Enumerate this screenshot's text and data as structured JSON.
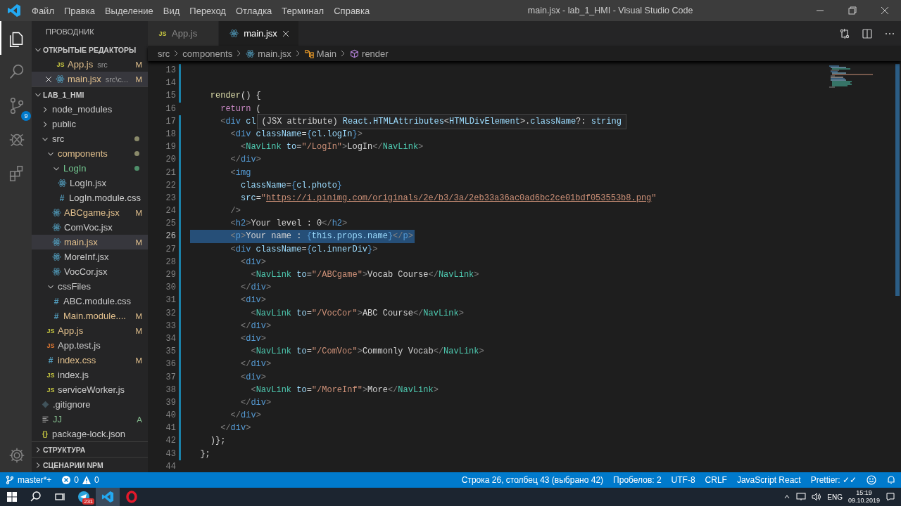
{
  "window": {
    "title": "main.jsx - lab_1_HMI - Visual Studio Code"
  },
  "menu": [
    "Файл",
    "Правка",
    "Выделение",
    "Вид",
    "Переход",
    "Отладка",
    "Терминал",
    "Справка"
  ],
  "activity_bar": [
    {
      "kind": "explorer",
      "selected": true
    },
    {
      "kind": "search",
      "selected": false
    },
    {
      "kind": "scm",
      "selected": false,
      "badge": "9"
    },
    {
      "kind": "debug",
      "selected": false
    },
    {
      "kind": "extensions",
      "selected": false
    }
  ],
  "sidebar": {
    "title": "ПРОВОДНИК",
    "open_editors": {
      "title": "ОТКРЫТЫЕ РЕДАКТОРЫ",
      "expanded": true,
      "items": [
        {
          "name": "App.js",
          "kind": "js",
          "icon": "JS",
          "description": "src",
          "status": "M",
          "color": "#e2c08d",
          "selected": false
        },
        {
          "name": "main.jsx",
          "kind": "react",
          "description": "src\\c...",
          "status": "M",
          "color": "#e2c08d",
          "selected": true
        }
      ]
    },
    "project": {
      "title": "LAB_1_HMI",
      "expanded": true,
      "tree": [
        {
          "name": "node_modules",
          "kind": "folder",
          "expanded": false,
          "color": "#cccccc",
          "selected": false
        },
        {
          "name": "public",
          "kind": "folder",
          "expanded": false,
          "color": "#cccccc",
          "selected": false
        },
        {
          "name": "src",
          "kind": "folder",
          "expanded": true,
          "color": "#cccccc",
          "dot": {
            "color": "#8a8a6a"
          },
          "selected": false,
          "children": [
            {
              "name": "components",
              "kind": "folder",
              "expanded": true,
              "color": "#e2c08d",
              "dot": {
                "color": "#8a8a6a"
              },
              "selected": false,
              "children": [
                {
                  "name": "LogIn",
                  "kind": "folder",
                  "expanded": true,
                  "color": "#73c991",
                  "dot": {
                    "color": "#4f8f6a"
                  },
                  "selected": false,
                  "children": [
                    {
                      "name": "LogIn.jsx",
                      "kind": "react",
                      "color": "#cccccc",
                      "selected": false
                    },
                    {
                      "name": "LogIn.module.css",
                      "kind": "css",
                      "icon": "#",
                      "color": "#cccccc",
                      "selected": false
                    }
                  ]
                },
                {
                  "name": "ABCgame.jsx",
                  "kind": "react",
                  "color": "#e2c08d",
                  "status": "M",
                  "selected": false
                },
                {
                  "name": "ComVoc.jsx",
                  "kind": "react",
                  "color": "#cccccc",
                  "selected": false
                },
                {
                  "name": "main.jsx",
                  "kind": "react",
                  "color": "#e2c08d",
                  "status": "M",
                  "selected": true
                },
                {
                  "name": "MoreInf.jsx",
                  "kind": "react",
                  "color": "#cccccc",
                  "selected": false
                },
                {
                  "name": "VocCor.jsx",
                  "kind": "react",
                  "color": "#cccccc",
                  "selected": false
                }
              ]
            },
            {
              "name": "cssFiles",
              "kind": "folder",
              "expanded": true,
              "color": "#cccccc",
              "selected": false,
              "children": [
                {
                  "name": "ABC.module.css",
                  "kind": "css",
                  "icon": "#",
                  "color": "#cccccc",
                  "selected": false
                },
                {
                  "name": "Main.module....",
                  "kind": "css",
                  "icon": "#",
                  "color": "#e2c08d",
                  "status": "M",
                  "selected": false
                }
              ]
            },
            {
              "name": "App.js",
              "kind": "js",
              "icon": "JS",
              "color": "#e2c08d",
              "status": "M",
              "selected": false
            },
            {
              "name": "App.test.js",
              "kind": "js-test",
              "icon": "JS",
              "color": "#cccccc",
              "selected": false
            },
            {
              "name": "index.css",
              "kind": "css",
              "icon": "#",
              "color": "#e2c08d",
              "status": "M",
              "selected": false
            },
            {
              "name": "index.js",
              "kind": "js",
              "icon": "JS",
              "color": "#cccccc",
              "selected": false
            },
            {
              "name": "serviceWorker.js",
              "kind": "js",
              "icon": "JS",
              "color": "#cccccc",
              "selected": false
            }
          ]
        },
        {
          "name": ".gitignore",
          "kind": "git",
          "color": "#cccccc",
          "selected": false
        },
        {
          "name": "JJ",
          "kind": "text",
          "color": "#81b88b",
          "status": "A",
          "selected": false
        },
        {
          "name": "package-lock.json",
          "kind": "json",
          "icon": "{}",
          "color": "#cccccc",
          "selected": false
        }
      ]
    },
    "bottom_sections": [
      {
        "title": "СТРУКТУРА",
        "expanded": false
      },
      {
        "title": "СЦЕНАРИИ NPM",
        "expanded": false
      }
    ]
  },
  "tabs": [
    {
      "label": "App.js",
      "kind": "js",
      "icon": "JS",
      "selected": false
    },
    {
      "label": "main.jsx",
      "kind": "react",
      "selected": true
    }
  ],
  "breadcrumbs": [
    {
      "label": "src",
      "kind": "plain"
    },
    {
      "label": "components",
      "kind": "plain"
    },
    {
      "label": "main.jsx",
      "kind": "react"
    },
    {
      "label": "Main",
      "kind": "class"
    },
    {
      "label": "render",
      "kind": "method"
    }
  ],
  "editor": {
    "lines": [
      {
        "n": "13",
        "modified": true,
        "selected": false
      },
      {
        "n": "14",
        "modified": true,
        "selected": false
      },
      {
        "n": "15",
        "modified": true,
        "selected": false,
        "tokens": [
          {
            "kind": "func",
            "text": "    render"
          },
          {
            "kind": "punct",
            "text": "() {"
          }
        ]
      },
      {
        "n": "16",
        "modified": false,
        "selected": false,
        "tokens": [
          {
            "kind": "keyword",
            "text": "      return"
          },
          {
            "kind": "punct",
            "text": " ("
          }
        ]
      },
      {
        "n": "17",
        "modified": true,
        "selected": false,
        "tokens": [
          {
            "kind": "bracket",
            "text": "      <"
          },
          {
            "kind": "tag",
            "text": "div"
          },
          {
            "kind": "attr",
            "text": " cl"
          }
        ]
      },
      {
        "n": "18",
        "modified": true,
        "selected": false,
        "tokens": [
          {
            "kind": "bracket",
            "text": "        <"
          },
          {
            "kind": "tag",
            "text": "div"
          },
          {
            "kind": "attr",
            "text": " className"
          },
          {
            "kind": "punct",
            "text": "="
          },
          {
            "kind": "tag",
            "text": "{"
          },
          {
            "kind": "attr",
            "text": "cl.logIn"
          },
          {
            "kind": "tag",
            "text": "}"
          },
          {
            "kind": "bracket",
            "text": ">"
          }
        ]
      },
      {
        "n": "19",
        "modified": true,
        "selected": false,
        "tokens": [
          {
            "kind": "bracket",
            "text": "          <"
          },
          {
            "kind": "comp",
            "text": "NavLink"
          },
          {
            "kind": "attr",
            "text": " to"
          },
          {
            "kind": "punct",
            "text": "="
          },
          {
            "kind": "string",
            "text": "\"/LogIn\""
          },
          {
            "kind": "bracket",
            "text": ">"
          },
          {
            "kind": "text",
            "text": "LogIn"
          },
          {
            "kind": "bracket",
            "text": "</"
          },
          {
            "kind": "comp",
            "text": "NavLink"
          },
          {
            "kind": "bracket",
            "text": ">"
          }
        ]
      },
      {
        "n": "20",
        "modified": true,
        "selected": false,
        "tokens": [
          {
            "kind": "bracket",
            "text": "        </"
          },
          {
            "kind": "tag",
            "text": "div"
          },
          {
            "kind": "bracket",
            "text": ">"
          }
        ]
      },
      {
        "n": "21",
        "modified": true,
        "selected": false,
        "tokens": [
          {
            "kind": "bracket",
            "text": "        <"
          },
          {
            "kind": "tag",
            "text": "img"
          }
        ]
      },
      {
        "n": "22",
        "modified": true,
        "selected": false,
        "tokens": [
          {
            "kind": "attr",
            "text": "          className"
          },
          {
            "kind": "punct",
            "text": "="
          },
          {
            "kind": "tag",
            "text": "{"
          },
          {
            "kind": "attr",
            "text": "cl.photo"
          },
          {
            "kind": "tag",
            "text": "}"
          }
        ]
      },
      {
        "n": "23",
        "modified": true,
        "selected": false,
        "tokens": [
          {
            "kind": "attr",
            "text": "          src"
          },
          {
            "kind": "punct",
            "text": "="
          },
          {
            "kind": "string",
            "text": "\""
          },
          {
            "kind": "link",
            "text": "https://i.pinimg.com/originals/2e/b3/3a/2eb33a36ac0ad6bc2ce01bdf053553b8.png"
          },
          {
            "kind": "string",
            "text": "\""
          }
        ]
      },
      {
        "n": "24",
        "modified": true,
        "selected": false,
        "tokens": [
          {
            "kind": "bracket",
            "text": "        />"
          }
        ]
      },
      {
        "n": "25",
        "modified": true,
        "selected": false,
        "tokens": [
          {
            "kind": "bracket",
            "text": "        <"
          },
          {
            "kind": "tag",
            "text": "h2"
          },
          {
            "kind": "bracket",
            "text": ">"
          },
          {
            "kind": "text",
            "text": "Your level : 0"
          },
          {
            "kind": "bracket",
            "text": "</"
          },
          {
            "kind": "tag",
            "text": "h2"
          },
          {
            "kind": "bracket",
            "text": ">"
          }
        ]
      },
      {
        "n": "26",
        "modified": true,
        "selected": true,
        "tokens": [
          {
            "kind": "bracket",
            "text": "        <"
          },
          {
            "kind": "tag",
            "text": "p"
          },
          {
            "kind": "bracket",
            "text": ">"
          },
          {
            "kind": "text",
            "text": "Your name : "
          },
          {
            "kind": "tag",
            "text": "{"
          },
          {
            "kind": "attr",
            "text": "this.props.name"
          },
          {
            "kind": "tag",
            "text": "}"
          },
          {
            "kind": "bracket",
            "text": "</"
          },
          {
            "kind": "tag",
            "text": "p"
          },
          {
            "kind": "bracket",
            "text": ">"
          }
        ]
      },
      {
        "n": "27",
        "modified": true,
        "selected": false,
        "tokens": [
          {
            "kind": "bracket",
            "text": "        <"
          },
          {
            "kind": "tag",
            "text": "div"
          },
          {
            "kind": "attr",
            "text": " className"
          },
          {
            "kind": "punct",
            "text": "="
          },
          {
            "kind": "tag",
            "text": "{"
          },
          {
            "kind": "attr",
            "text": "cl.innerDiv"
          },
          {
            "kind": "tag",
            "text": "}"
          },
          {
            "kind": "bracket",
            "text": ">"
          }
        ]
      },
      {
        "n": "28",
        "modified": true,
        "selected": false,
        "tokens": [
          {
            "kind": "bracket",
            "text": "          <"
          },
          {
            "kind": "tag",
            "text": "div"
          },
          {
            "kind": "bracket",
            "text": ">"
          }
        ]
      },
      {
        "n": "29",
        "modified": true,
        "selected": false,
        "tokens": [
          {
            "kind": "bracket",
            "text": "            <"
          },
          {
            "kind": "comp",
            "text": "NavLink"
          },
          {
            "kind": "attr",
            "text": " to"
          },
          {
            "kind": "punct",
            "text": "="
          },
          {
            "kind": "string",
            "text": "\"/ABCgame\""
          },
          {
            "kind": "bracket",
            "text": ">"
          },
          {
            "kind": "text",
            "text": "Vocab Course"
          },
          {
            "kind": "bracket",
            "text": "</"
          },
          {
            "kind": "comp",
            "text": "NavLink"
          },
          {
            "kind": "bracket",
            "text": ">"
          }
        ]
      },
      {
        "n": "30",
        "modified": true,
        "selected": false,
        "tokens": [
          {
            "kind": "bracket",
            "text": "          </"
          },
          {
            "kind": "tag",
            "text": "div"
          },
          {
            "kind": "bracket",
            "text": ">"
          }
        ]
      },
      {
        "n": "31",
        "modified": true,
        "selected": false,
        "tokens": [
          {
            "kind": "bracket",
            "text": "          <"
          },
          {
            "kind": "tag",
            "text": "div"
          },
          {
            "kind": "bracket",
            "text": ">"
          }
        ]
      },
      {
        "n": "32",
        "modified": true,
        "selected": false,
        "tokens": [
          {
            "kind": "bracket",
            "text": "            <"
          },
          {
            "kind": "comp",
            "text": "NavLink"
          },
          {
            "kind": "attr",
            "text": " to"
          },
          {
            "kind": "punct",
            "text": "="
          },
          {
            "kind": "string",
            "text": "\"/VocCor\""
          },
          {
            "kind": "bracket",
            "text": ">"
          },
          {
            "kind": "text",
            "text": "ABC Course"
          },
          {
            "kind": "bracket",
            "text": "</"
          },
          {
            "kind": "comp",
            "text": "NavLink"
          },
          {
            "kind": "bracket",
            "text": ">"
          }
        ]
      },
      {
        "n": "33",
        "modified": true,
        "selected": false,
        "tokens": [
          {
            "kind": "bracket",
            "text": "          </"
          },
          {
            "kind": "tag",
            "text": "div"
          },
          {
            "kind": "bracket",
            "text": ">"
          }
        ]
      },
      {
        "n": "34",
        "modified": true,
        "selected": false,
        "tokens": [
          {
            "kind": "bracket",
            "text": "          <"
          },
          {
            "kind": "tag",
            "text": "div"
          },
          {
            "kind": "bracket",
            "text": ">"
          }
        ]
      },
      {
        "n": "35",
        "modified": true,
        "selected": false,
        "tokens": [
          {
            "kind": "bracket",
            "text": "            <"
          },
          {
            "kind": "comp",
            "text": "NavLink"
          },
          {
            "kind": "attr",
            "text": " to"
          },
          {
            "kind": "punct",
            "text": "="
          },
          {
            "kind": "string",
            "text": "\"/ComVoc\""
          },
          {
            "kind": "bracket",
            "text": ">"
          },
          {
            "kind": "text",
            "text": "Commonly Vocab"
          },
          {
            "kind": "bracket",
            "text": "</"
          },
          {
            "kind": "comp",
            "text": "NavLink"
          },
          {
            "kind": "bracket",
            "text": ">"
          }
        ]
      },
      {
        "n": "36",
        "modified": true,
        "selected": false,
        "tokens": [
          {
            "kind": "bracket",
            "text": "          </"
          },
          {
            "kind": "tag",
            "text": "div"
          },
          {
            "kind": "bracket",
            "text": ">"
          }
        ]
      },
      {
        "n": "37",
        "modified": true,
        "selected": false,
        "tokens": [
          {
            "kind": "bracket",
            "text": "          <"
          },
          {
            "kind": "tag",
            "text": "div"
          },
          {
            "kind": "bracket",
            "text": ">"
          }
        ]
      },
      {
        "n": "38",
        "modified": true,
        "selected": false,
        "tokens": [
          {
            "kind": "bracket",
            "text": "            <"
          },
          {
            "kind": "comp",
            "text": "NavLink"
          },
          {
            "kind": "attr",
            "text": " to"
          },
          {
            "kind": "punct",
            "text": "="
          },
          {
            "kind": "string",
            "text": "\"/MoreInf\""
          },
          {
            "kind": "bracket",
            "text": ">"
          },
          {
            "kind": "text",
            "text": "More"
          },
          {
            "kind": "bracket",
            "text": "</"
          },
          {
            "kind": "comp",
            "text": "NavLink"
          },
          {
            "kind": "bracket",
            "text": ">"
          }
        ]
      },
      {
        "n": "39",
        "modified": true,
        "selected": false,
        "tokens": [
          {
            "kind": "bracket",
            "text": "          </"
          },
          {
            "kind": "tag",
            "text": "div"
          },
          {
            "kind": "bracket",
            "text": ">"
          }
        ]
      },
      {
        "n": "40",
        "modified": true,
        "selected": false,
        "tokens": [
          {
            "kind": "bracket",
            "text": "        </"
          },
          {
            "kind": "tag",
            "text": "div"
          },
          {
            "kind": "bracket",
            "text": ">"
          }
        ]
      },
      {
        "n": "41",
        "modified": true,
        "selected": false,
        "tokens": [
          {
            "kind": "bracket",
            "text": "      </"
          },
          {
            "kind": "tag",
            "text": "div"
          },
          {
            "kind": "bracket",
            "text": ">"
          }
        ]
      },
      {
        "n": "42",
        "modified": true,
        "selected": false,
        "tokens": [
          {
            "kind": "punct",
            "text": "    )};"
          }
        ]
      },
      {
        "n": "43",
        "modified": true,
        "selected": false,
        "tokens": [
          {
            "kind": "punct",
            "text": "  };"
          }
        ]
      },
      {
        "n": "44",
        "modified": false,
        "selected": false
      }
    ],
    "tooltip": {
      "tokens": [
        {
          "kind": "text",
          "text": "(JSX attribute) "
        },
        {
          "kind": "attr",
          "text": "React.HTMLAttributes"
        },
        {
          "kind": "punct",
          "text": "<"
        },
        {
          "kind": "attr",
          "text": "HTMLDivElement"
        },
        {
          "kind": "punct",
          "text": ">."
        },
        {
          "kind": "attr",
          "text": "className"
        },
        {
          "kind": "punct",
          "text": "?: "
        },
        {
          "kind": "attr",
          "text": "string"
        }
      ]
    }
  },
  "status_bar": {
    "branch": "master*+",
    "errors": "0",
    "warnings": "0",
    "right": [
      "Строка 26, столбец 43 (выбрано 42)",
      "Пробелов: 2",
      "UTF-8",
      "CRLF",
      "JavaScript React",
      "Prettier: ✓✓"
    ]
  },
  "taskbar": {
    "apps": [
      {
        "kind": "telegram",
        "badge": "231",
        "selected": false
      },
      {
        "kind": "vscode",
        "selected": true
      },
      {
        "kind": "opera",
        "selected": false
      }
    ],
    "language": "ENG",
    "time": "15:19",
    "date": "09.10.2019"
  }
}
